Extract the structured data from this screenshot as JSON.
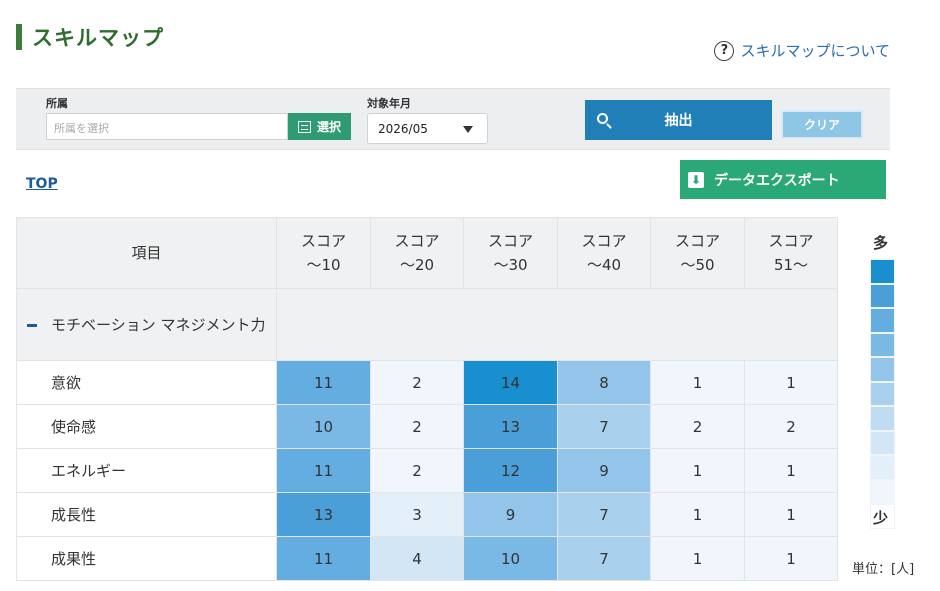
{
  "header": {
    "title": "スキルマップ",
    "help_label": "スキルマップについて"
  },
  "filters": {
    "org_label": "所属",
    "org_placeholder": "所属を選択",
    "select_label": "選択",
    "ym_label": "対象年月",
    "ym_value": "2026/05",
    "extract_label": "抽出",
    "clear_label": "クリア"
  },
  "nav": {
    "top_label": "TOP",
    "export_label": "データエクスポート"
  },
  "table": {
    "item_header": "項目",
    "columns": [
      [
        "スコア",
        "〜10"
      ],
      [
        "スコア",
        "〜20"
      ],
      [
        "スコア",
        "〜30"
      ],
      [
        "スコア",
        "〜40"
      ],
      [
        "スコア",
        "〜50"
      ],
      [
        "スコア",
        "51〜"
      ]
    ],
    "group_label": "モチベーション マネジメント力",
    "rows": [
      {
        "label": "意欲",
        "values": [
          11,
          2,
          14,
          8,
          1,
          1
        ]
      },
      {
        "label": "使命感",
        "values": [
          10,
          2,
          13,
          7,
          2,
          2
        ]
      },
      {
        "label": "エネルギー",
        "values": [
          11,
          2,
          12,
          9,
          1,
          1
        ]
      },
      {
        "label": "成長性",
        "values": [
          13,
          3,
          9,
          7,
          1,
          1
        ]
      },
      {
        "label": "成果性",
        "values": [
          11,
          4,
          10,
          7,
          1,
          1
        ]
      }
    ]
  },
  "legend": {
    "many_label": "多",
    "few_label": "少",
    "unit_label": "単位：[人]",
    "colors": [
      "#1a8fd0",
      "#4a9fd9",
      "#63ade0",
      "#7ab8e5",
      "#93c5ea",
      "#a9d1ee",
      "#bfdcf2",
      "#d2e6f6",
      "#e3f0f9",
      "#f0f6fc",
      "#ffffff"
    ]
  }
}
